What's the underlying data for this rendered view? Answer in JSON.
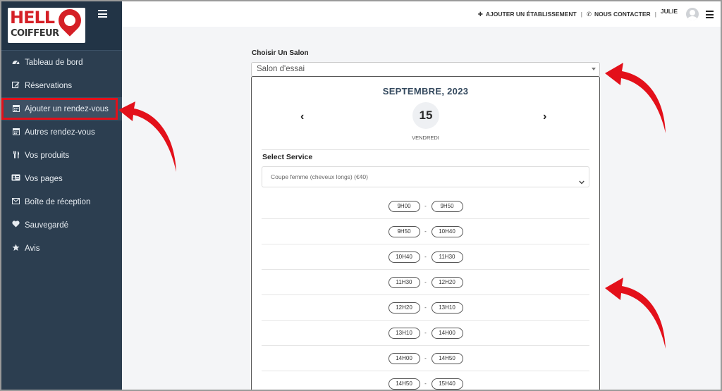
{
  "brand": {
    "logo_line1": "HELL",
    "logo_line2": "COIFFEUR",
    "primary_color": "#d51f26",
    "sidebar_color": "#2c3e50"
  },
  "topbar": {
    "add_business": "AJOUTER UN ÉTABLISSEMENT",
    "contact": "NOUS CONTACTER",
    "user_name": "JULIE"
  },
  "sidebar": {
    "items": [
      {
        "label": "Tableau de bord",
        "icon": "dashboard-icon"
      },
      {
        "label": "Réservations",
        "icon": "edit-icon"
      },
      {
        "label": "Ajouter un rendez-vous",
        "icon": "calendar-icon",
        "active": true
      },
      {
        "label": "Autres rendez-vous",
        "icon": "calendar-icon"
      },
      {
        "label": "Vos produits",
        "icon": "utensils-icon"
      },
      {
        "label": "Vos pages",
        "icon": "id-card-icon"
      },
      {
        "label": "Boîte de réception",
        "icon": "envelope-icon"
      },
      {
        "label": "Sauvegardé",
        "icon": "heart-icon"
      },
      {
        "label": "Avis",
        "icon": "star-icon"
      }
    ]
  },
  "booking": {
    "salon_label": "Choisir Un Salon",
    "salon_value": "Salon d'essai",
    "month": "SEPTEMBRE, 2023",
    "day_number": "15",
    "weekday": "VENDREDI",
    "service_label": "Select Service",
    "service_value": "Coupe femme (cheveux longs) (€40)",
    "slots": [
      {
        "start": "9H00",
        "end": "9H50"
      },
      {
        "start": "9H50",
        "end": "10H40"
      },
      {
        "start": "10H40",
        "end": "11H30"
      },
      {
        "start": "11H30",
        "end": "12H20"
      },
      {
        "start": "12H20",
        "end": "13H10"
      },
      {
        "start": "13H10",
        "end": "14H00"
      },
      {
        "start": "14H00",
        "end": "14H50"
      },
      {
        "start": "14H50",
        "end": "15H40"
      }
    ]
  }
}
